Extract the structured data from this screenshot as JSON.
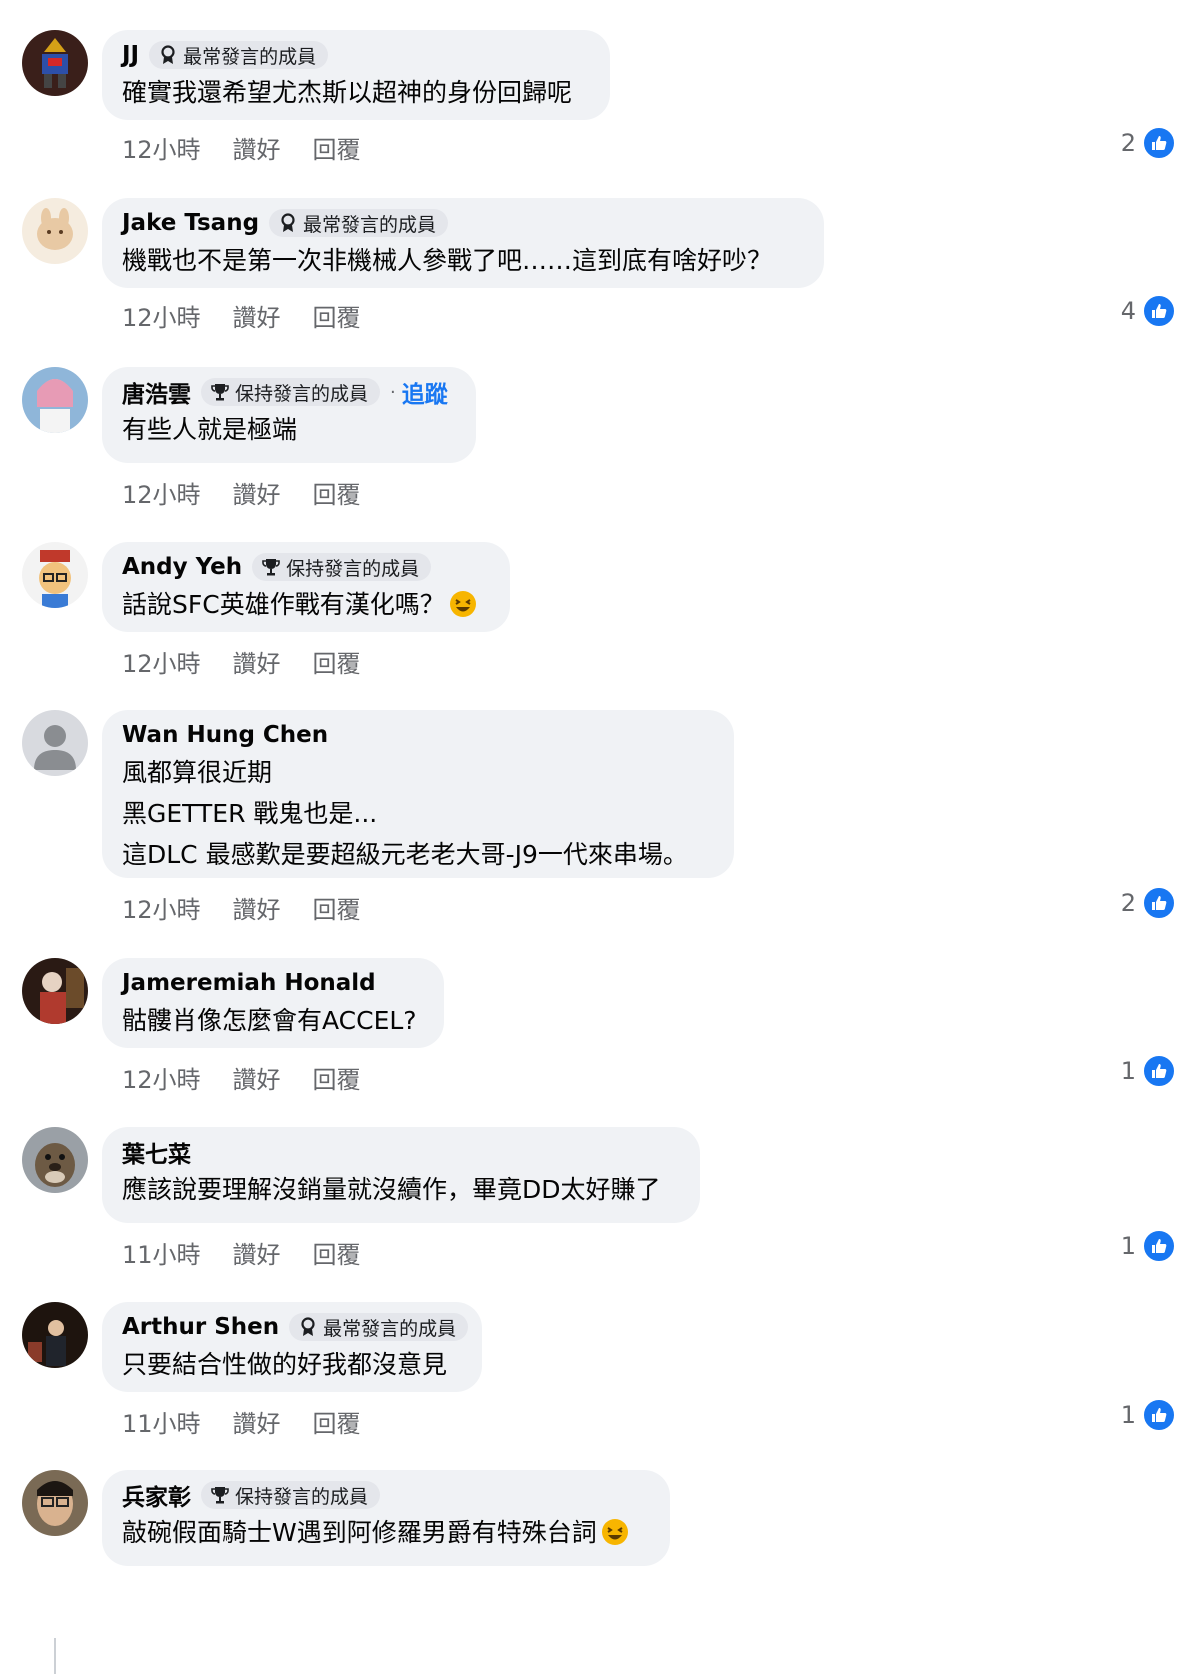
{
  "comments": [
    {
      "author": "JJ",
      "badge": "最常發言的成員",
      "badge_icon": "top-fan-icon",
      "follow": "",
      "lines": [
        "確實我還希望尤杰斯以超神的身份回歸呢"
      ],
      "time": "12小時",
      "like_label": "讚好",
      "reply_label": "回覆",
      "reactions": "2"
    },
    {
      "author": "Jake Tsang",
      "badge": "最常發言的成員",
      "badge_icon": "top-fan-icon",
      "follow": "",
      "lines": [
        "機戰也不是第一次非機械人參戰了吧……這到底有啥好吵？"
      ],
      "time": "12小時",
      "like_label": "讚好",
      "reply_label": "回覆",
      "reactions": "4"
    },
    {
      "author": "唐浩雲",
      "badge": "保持發言的成員",
      "badge_icon": "trophy-icon",
      "follow": "追蹤",
      "lines": [
        "有些人就是極端"
      ],
      "time": "12小時",
      "like_label": "讚好",
      "reply_label": "回覆",
      "reactions": ""
    },
    {
      "author": "Andy Yeh",
      "badge": "保持發言的成員",
      "badge_icon": "trophy-icon",
      "follow": "",
      "lines": [
        "話說SFC英雄作戰有漢化嗎？"
      ],
      "emoji": "laughing-emoji",
      "time": "12小時",
      "like_label": "讚好",
      "reply_label": "回覆",
      "reactions": ""
    },
    {
      "author": "Wan Hung Chen",
      "badge": "",
      "follow": "",
      "lines": [
        "風都算很近期",
        "黑GETTER 戰鬼也是...",
        "這DLC 最感歎是要超級元老老大哥-J9一代來串場。"
      ],
      "time": "12小時",
      "like_label": "讚好",
      "reply_label": "回覆",
      "reactions": "2"
    },
    {
      "author": "Jameremiah Honald",
      "badge": "",
      "follow": "",
      "lines": [
        "骷髏肖像怎麼會有ACCEL?"
      ],
      "time": "12小時",
      "like_label": "讚好",
      "reply_label": "回覆",
      "reactions": "1"
    },
    {
      "author": "葉七菜",
      "badge": "",
      "follow": "",
      "lines": [
        "應該說要理解沒銷量就沒續作，畢竟DD太好賺了"
      ],
      "time": "11小時",
      "like_label": "讚好",
      "reply_label": "回覆",
      "reactions": "1"
    },
    {
      "author": "Arthur Shen",
      "badge": "最常發言的成員",
      "badge_icon": "top-fan-icon",
      "follow": "",
      "lines": [
        "只要結合性做的好我都沒意見"
      ],
      "time": "11小時",
      "like_label": "讚好",
      "reply_label": "回覆",
      "reactions": "1"
    },
    {
      "author": "兵家彰",
      "badge": "保持發言的成員",
      "badge_icon": "trophy-icon",
      "follow": "",
      "lines": [
        "敲碗假面騎士W遇到阿修羅男爵有特殊台詞"
      ],
      "emoji": "laughing-emoji",
      "time": "",
      "like_label": "",
      "reply_label": "",
      "reactions": ""
    }
  ],
  "colors": {
    "bubble": "#f0f2f5",
    "badge": "#e4e6eb",
    "meta_text": "#65676b",
    "link_blue": "#1877f2",
    "like_blue": "#1877f2"
  }
}
